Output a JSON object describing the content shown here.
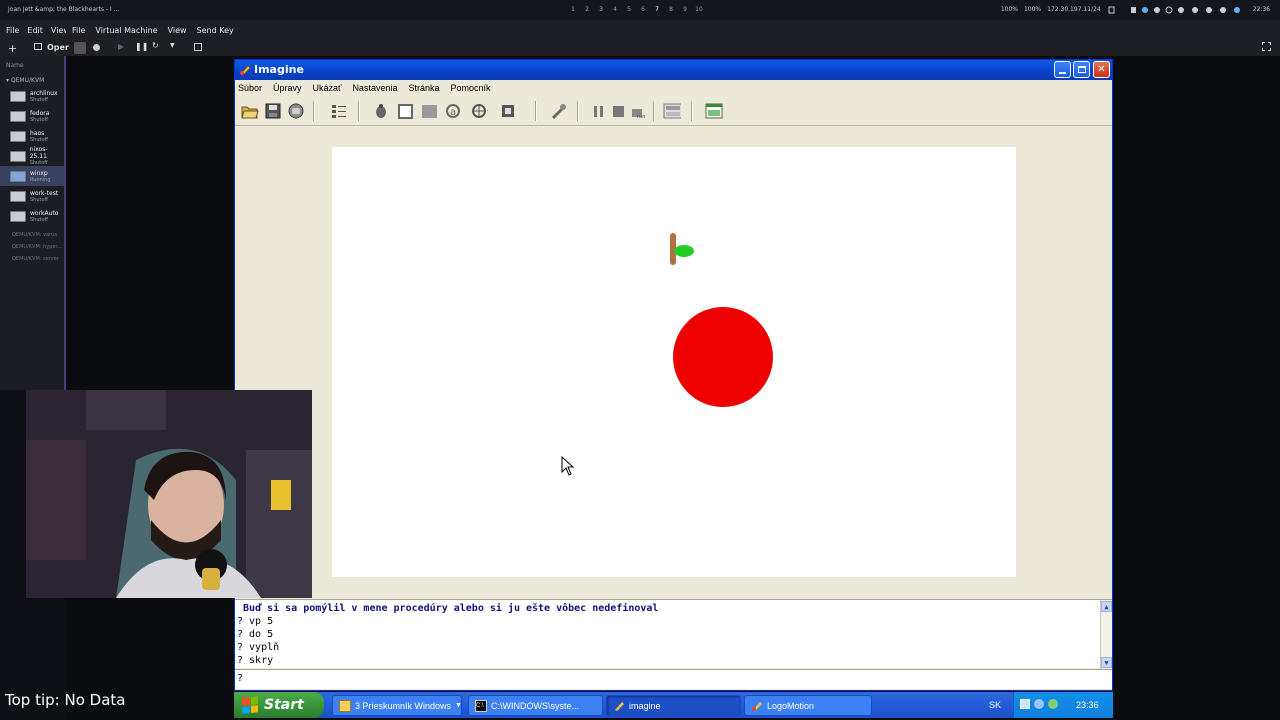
{
  "topbar": {
    "title": "Joan Jett &amp; the Blackhearts - I ...",
    "workspaces": [
      "1",
      "2",
      "3",
      "4",
      "5",
      "6",
      "7",
      "8",
      "9",
      "10"
    ],
    "active_workspace": "7",
    "volume1": "100%",
    "volume2": "100%",
    "ip": "172.30.197.11/24",
    "clock": "22:36"
  },
  "host_menu_left": [
    "File",
    "Edit",
    "View"
  ],
  "host_menu_right": [
    "File",
    "Virtual Machine",
    "View",
    "Send Key"
  ],
  "host_toolbar": {
    "open_label": "Oper"
  },
  "vm_sidebar": {
    "name_header": "Name",
    "group": "QEMU/KVM",
    "vms": [
      {
        "name": "archlinux",
        "status": "Shutoff"
      },
      {
        "name": "fedora",
        "status": "Shutoff"
      },
      {
        "name": "haos",
        "status": "Shutoff"
      },
      {
        "name": "nixos-25.11",
        "status": "Shutoff"
      },
      {
        "name": "winxp",
        "status": "Running"
      },
      {
        "name": "work-test",
        "status": "Shutoff"
      },
      {
        "name": "workAuto",
        "status": "Shutoff"
      }
    ],
    "connections": [
      "QEMU/KVM: varux",
      "QEMU/KVM: hyper...",
      "QEMU/KVM: server"
    ]
  },
  "xp_window": {
    "title": "Imagine",
    "menu": [
      "Súbor",
      "Úpravy",
      "Ukázať",
      "Nastavenia",
      "Stránka",
      "Pomocník"
    ],
    "console": [
      {
        "text": " Buď si sa pomýlil v mene procedúry alebo si ju ešte vôbec nedefinoval",
        "type": "err"
      },
      {
        "text": "? vp 5",
        "type": "cmd"
      },
      {
        "text": "? do 5",
        "type": "cmd"
      },
      {
        "text": "? vyplň",
        "type": "cmd"
      },
      {
        "text": "? skry",
        "type": "cmd"
      }
    ],
    "prompt": "?"
  },
  "taskbar": {
    "start": "Start",
    "tasks": [
      "3 Prieskumník Windows",
      "C:\\WINDOWS\\syste...",
      "imagine",
      "LogoMotion"
    ],
    "lang": "SK",
    "clock": "23:36"
  },
  "overlay": {
    "top_tip": "Top tip: No Data"
  },
  "colors": {
    "xp_blue": "#0a5be6",
    "xp_face": "#ece9d8",
    "circle": "#ee0000",
    "turtle_shell": "#22cc22",
    "turtle_stick": "#b07040"
  }
}
